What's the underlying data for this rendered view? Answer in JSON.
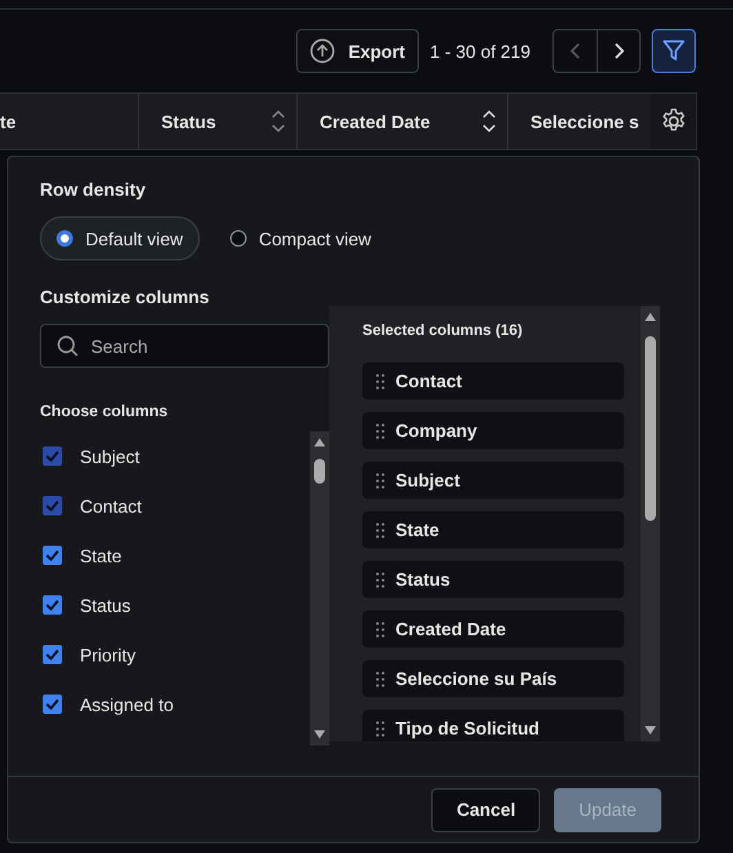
{
  "toolbar": {
    "export_label": "Export",
    "pagination": "1 - 30 of 219",
    "prev_disabled": true,
    "filter_active": true
  },
  "table": {
    "columns": [
      {
        "label": "te",
        "sortable": false
      },
      {
        "label": "Status",
        "sortable": true
      },
      {
        "label": "Created Date",
        "sortable": true
      },
      {
        "label": "Seleccione s",
        "sortable": false
      }
    ]
  },
  "popup": {
    "row_density": {
      "title": "Row density",
      "options": [
        {
          "label": "Default view",
          "selected": true
        },
        {
          "label": "Compact view",
          "selected": false
        }
      ]
    },
    "customize_title": "Customize columns",
    "search": {
      "placeholder": "Search"
    },
    "choose_title": "Choose columns",
    "choose_items": [
      {
        "label": "Subject",
        "checked": true,
        "disabled": true
      },
      {
        "label": "Contact",
        "checked": true,
        "disabled": true
      },
      {
        "label": "State",
        "checked": true,
        "disabled": false
      },
      {
        "label": "Status",
        "checked": true,
        "disabled": false
      },
      {
        "label": "Priority",
        "checked": true,
        "disabled": false
      },
      {
        "label": "Assigned to",
        "checked": true,
        "disabled": false
      }
    ],
    "selected_title": "Selected columns (16)",
    "selected_items": [
      "Contact",
      "Company",
      "Subject",
      "State",
      "Status",
      "Created Date",
      "Seleccione su País",
      "Tipo de Solicitud"
    ],
    "buttons": [
      {
        "label": "Cancel",
        "kind": "secondary",
        "disabled": false
      },
      {
        "label": "Update",
        "kind": "primary",
        "disabled": true
      }
    ]
  }
}
